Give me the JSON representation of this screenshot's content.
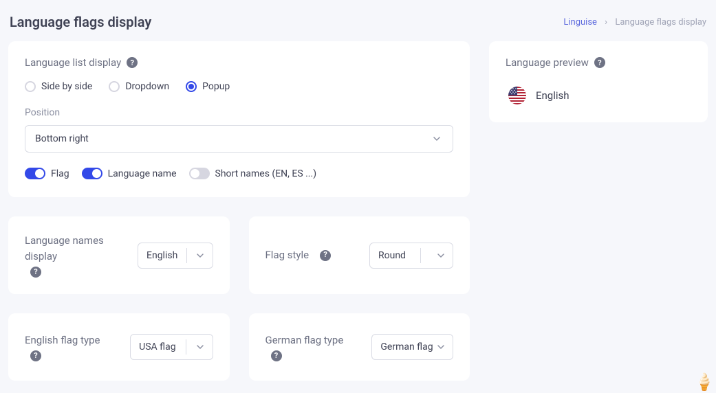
{
  "page_title": "Language flags display",
  "breadcrumb": {
    "root": "Linguise",
    "current": "Language flags display"
  },
  "list_display": {
    "section_label": "Language list display",
    "options": [
      "Side by side",
      "Dropdown",
      "Popup"
    ],
    "selected": "Popup",
    "position_label": "Position",
    "position_value": "Bottom right",
    "toggles": {
      "flag": {
        "label": "Flag",
        "on": true
      },
      "language_name": {
        "label": "Language name",
        "on": true
      },
      "short_names": {
        "label": "Short names (EN, ES ...)",
        "on": false
      }
    }
  },
  "names_display": {
    "label": "Language names display",
    "value": "English"
  },
  "flag_style": {
    "label": "Flag style",
    "value": "Round"
  },
  "english_flag": {
    "label": "English flag type",
    "value": "USA flag"
  },
  "german_flag": {
    "label": "German flag type",
    "value": "German flag"
  },
  "preview": {
    "label": "Language preview",
    "language": "English"
  }
}
